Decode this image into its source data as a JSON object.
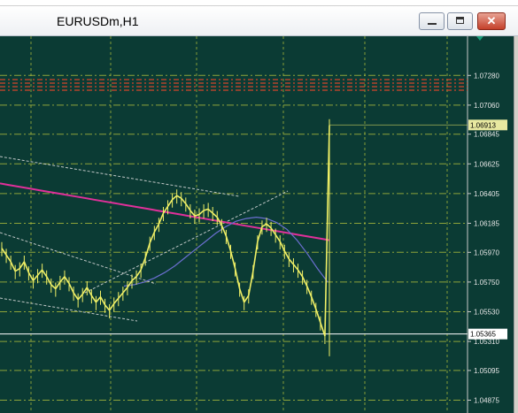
{
  "window": {
    "title": "EURUSDm,H1"
  },
  "chart_data": {
    "type": "line",
    "symbol": "EURUSDm",
    "timeframe": "H1",
    "price_axis_ticks": [
      "1.07280",
      "1.07060",
      "1.06845",
      "1.06625",
      "1.06405",
      "1.06185",
      "1.05970",
      "1.05750",
      "1.05530",
      "1.05310",
      "1.05095",
      "1.04875"
    ],
    "ylim": [
      1.0478,
      1.0757
    ],
    "current_price_label": "1.06913",
    "horizontal_level_label": "1.05365",
    "price_series": {
      "name": "",
      "values": [
        1.06,
        1.0595,
        1.059,
        1.0583,
        1.0585,
        1.059,
        1.0582,
        1.0576,
        1.058,
        1.0584,
        1.0579,
        1.0573,
        1.057,
        1.0575,
        1.0579,
        1.0574,
        1.0567,
        1.0562,
        1.0566,
        1.0571,
        1.0565,
        1.056,
        1.0564,
        1.0558,
        1.0554,
        1.0559,
        1.0563,
        1.0567,
        1.0571,
        1.0576,
        1.0579,
        1.0584,
        1.0593,
        1.0604,
        1.0612,
        1.0618,
        1.0626,
        1.0631,
        1.0636,
        1.0639,
        1.0637,
        1.0633,
        1.0628,
        1.0624,
        1.0625,
        1.0628,
        1.0629,
        1.0626,
        1.0623,
        1.0617,
        1.0609,
        1.0598,
        1.0585,
        1.057,
        1.056,
        1.0565,
        1.0583,
        1.0605,
        1.0616,
        1.0618,
        1.0615,
        1.061,
        1.0605,
        1.0598,
        1.0592,
        1.0588,
        1.0584,
        1.0579,
        1.0572,
        1.0564,
        1.0555,
        1.0545,
        1.0535,
        1.0691
      ]
    },
    "moving_averages": [
      {
        "name": "",
        "color": "#e0309a",
        "values": [
          1.0648,
          1.0647,
          1.0646,
          1.0645,
          1.0644,
          1.0643,
          1.0642,
          1.0641,
          1.064,
          1.0639,
          1.0638,
          1.0637,
          1.0636,
          1.0635,
          1.0634,
          1.0633,
          1.0632,
          1.0631,
          1.063,
          1.0629,
          1.0628,
          1.0627,
          1.0626,
          1.0625,
          1.0624,
          1.0623,
          1.0622,
          1.0621,
          1.062,
          1.0619,
          1.0618,
          1.0617,
          1.0616,
          1.0615,
          1.0614,
          1.0613,
          1.0612,
          1.0611,
          1.061,
          1.0609,
          1.0608,
          1.0607,
          1.0606
        ]
      },
      {
        "name": "",
        "color": "#6b6fd0",
        "values": [
          1.0572,
          1.0573,
          1.0575,
          1.0578,
          1.0582,
          1.0587,
          1.0593,
          1.0599,
          1.0605,
          1.0611,
          1.0616,
          1.062,
          1.0622,
          1.0623,
          1.0622,
          1.0619,
          1.0614,
          1.0606,
          1.0596,
          1.0585,
          1.0575
        ]
      }
    ],
    "grid": true
  }
}
